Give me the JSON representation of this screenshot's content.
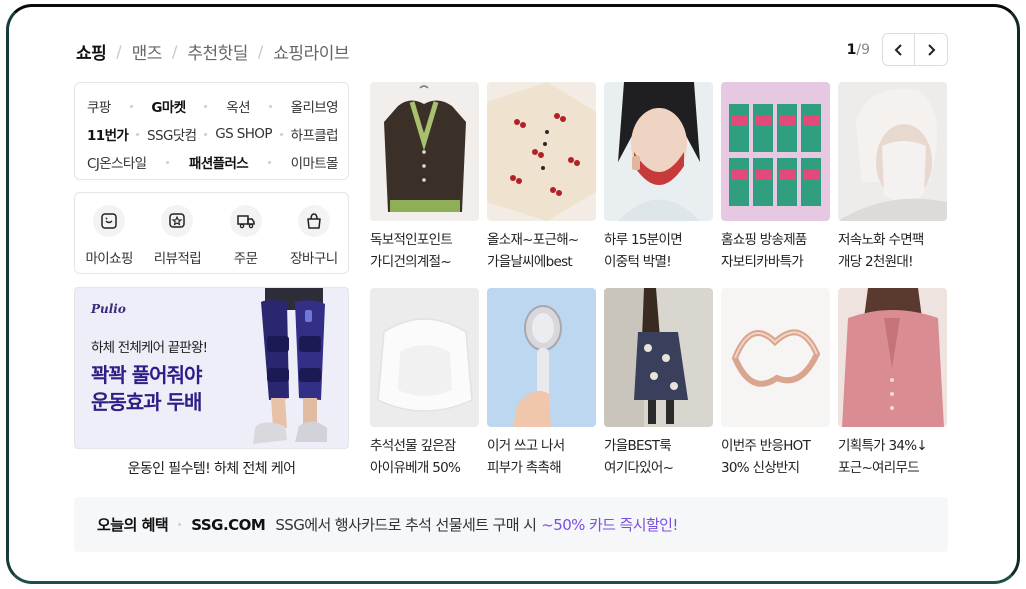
{
  "tabs": [
    {
      "label": "쇼핑",
      "active": true
    },
    {
      "label": "맨즈",
      "active": false
    },
    {
      "label": "추천핫딜",
      "active": false
    },
    {
      "label": "쇼핑라이브",
      "active": false
    }
  ],
  "pager": {
    "current": "1",
    "total": "/9"
  },
  "malls": {
    "row1": [
      "쿠팡",
      "G마켓",
      "옥션",
      "올리브영"
    ],
    "row2": [
      "11번가",
      "SSG닷컴",
      "GS SHOP",
      "하프클럽"
    ],
    "row3": [
      "CJ온스타일",
      "패션플러스",
      "이마트몰"
    ]
  },
  "quick": [
    {
      "label": "마이쇼핑",
      "icon": "my-shopping-icon"
    },
    {
      "label": "리뷰적립",
      "icon": "review-star-icon"
    },
    {
      "label": "주문",
      "icon": "delivery-truck-icon"
    },
    {
      "label": "장바구니",
      "icon": "shopping-bag-icon"
    }
  ],
  "ad": {
    "brand": "Pulio",
    "sub": "하체 전체케어 끝판왕!",
    "main1": "꽉꽉 풀어줘야",
    "main2": "운동효과 두배",
    "caption": "운동인 필수템! 하체 전체 케어"
  },
  "products": [
    {
      "line1": "독보적인포인트",
      "line2": "가디건의계절~"
    },
    {
      "line1": "올소재~포근해~",
      "line2": "가을날씨에best"
    },
    {
      "line1": "하루 15분이면",
      "line2": "이중턱 박멸!"
    },
    {
      "line1": "홈쇼핑 방송제품",
      "line2": "자보티카바특가"
    },
    {
      "line1": "저속노화 수면팩",
      "line2": "개당 2천원대!"
    },
    {
      "line1": "추석선물 깊은잠",
      "line2": "아이유베개 50%"
    },
    {
      "line1": "이거 쓰고 나서",
      "line2": "피부가 촉촉해"
    },
    {
      "line1": "가을BEST룩",
      "line2": "여기다있어~"
    },
    {
      "line1": "이번주 반응HOT",
      "line2": "30% 신상반지"
    },
    {
      "line1": "기획특가 34%↓",
      "line2": "포근~여리무드"
    }
  ],
  "benefit": {
    "title": "오늘의 혜택",
    "brand": "SSG.COM",
    "text": "SSG에서 행사카드로 추석 선물세트 구매 시",
    "highlight": "~50% 카드 즉시할인!"
  },
  "colors": {
    "accent": "#7b4fe0",
    "ad_text": "#2e1d86",
    "border": "#e5e5e5"
  }
}
